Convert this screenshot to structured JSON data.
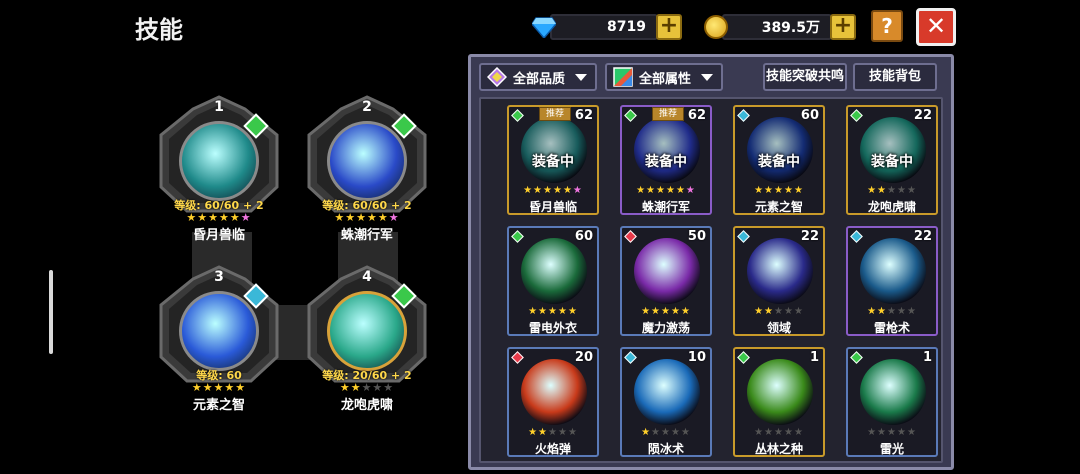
{
  "header": {
    "title": "技能"
  },
  "currency": {
    "gems": "8719",
    "coins": "389.5万",
    "plus": "+",
    "gem_color": "#2aa8ff",
    "coin_color": "#ffd23a"
  },
  "buttons": {
    "help": "?",
    "close": "✕"
  },
  "slots": [
    {
      "num": "1",
      "level": "等级: 60/60 + 2",
      "stars": "★★★★★",
      "extra": "★",
      "name": "昏月兽临",
      "orb": "#1f8a8a",
      "badge": "#3ac84a"
    },
    {
      "num": "2",
      "level": "等级: 60/60 + 2",
      "stars": "★★★★★",
      "extra": "★",
      "name": "蛛潮行军",
      "orb": "#2a4ac8",
      "badge": "#3ac84a"
    },
    {
      "num": "3",
      "level": "等级: 60",
      "stars": "★★★★★",
      "extra": "",
      "name": "元素之智",
      "orb": "#2a5ad8",
      "badge": "#3ab8d8"
    },
    {
      "num": "4",
      "level": "等级: 20/60 + 2",
      "stars": "★★",
      "extra": "★★★",
      "name": "龙咆虎啸",
      "orb": "#2aa88a",
      "badge": "#3ac84a"
    }
  ],
  "panel": {
    "filter_quality": "全部品质",
    "filter_attribute": "全部属性",
    "btn_resonance": "技能突破共鸣",
    "btn_bag": "技能背包"
  },
  "cards": [
    {
      "name": "昏月兽临",
      "count": "62",
      "rec": "推荐",
      "equipped": "装备中",
      "stars": "★★★★★",
      "dim": "",
      "extra": "★",
      "orb": "#1f7a7a",
      "gem": "#3ac84a",
      "border": "gold"
    },
    {
      "name": "蛛潮行军",
      "count": "62",
      "rec": "推荐",
      "equipped": "装备中",
      "stars": "★★★★★",
      "dim": "",
      "extra": "★",
      "orb": "#2a3ab8",
      "gem": "#3ac84a",
      "border": "purple"
    },
    {
      "name": "元素之智",
      "count": "60",
      "rec": "",
      "equipped": "装备中",
      "stars": "★★★★★",
      "dim": "",
      "extra": "",
      "orb": "#1a3a9a",
      "gem": "#3ab8d8",
      "border": "gold"
    },
    {
      "name": "龙咆虎啸",
      "count": "22",
      "rec": "",
      "equipped": "装备中",
      "stars": "★★",
      "dim": "★★★",
      "extra": "",
      "orb": "#1a8a7a",
      "gem": "#3ac84a",
      "border": "gold"
    },
    {
      "name": "雷电外衣",
      "count": "60",
      "rec": "",
      "equipped": "",
      "stars": "★★★★★",
      "dim": "",
      "extra": "",
      "orb": "#1a6a3a",
      "gem": "#3ac84a",
      "border": "blue"
    },
    {
      "name": "魔力激荡",
      "count": "50",
      "rec": "",
      "equipped": "",
      "stars": "★★★★★",
      "dim": "",
      "extra": "",
      "orb": "#7a2aa8",
      "gem": "#e83a4a",
      "border": "blue"
    },
    {
      "name": "领域",
      "count": "22",
      "rec": "",
      "equipped": "",
      "stars": "★★",
      "dim": "★★★",
      "extra": "",
      "orb": "#2a2a8a",
      "gem": "#3ab8d8",
      "border": "gold"
    },
    {
      "name": "雷枪术",
      "count": "22",
      "rec": "",
      "equipped": "",
      "stars": "★★",
      "dim": "★★★",
      "extra": "",
      "orb": "#1a5a8a",
      "gem": "#3ab8d8",
      "border": "purple"
    },
    {
      "name": "火焰弹",
      "count": "20",
      "rec": "",
      "equipped": "",
      "stars": "★★",
      "dim": "★★★",
      "extra": "",
      "orb": "#c83a1a",
      "gem": "#e83a4a",
      "border": "blue"
    },
    {
      "name": "陨冰术",
      "count": "10",
      "rec": "",
      "equipped": "",
      "stars": "★",
      "dim": "★★★★",
      "extra": "",
      "orb": "#1a6ab8",
      "gem": "#3ab8d8",
      "border": "blue"
    },
    {
      "name": "丛林之种",
      "count": "1",
      "rec": "",
      "equipped": "",
      "stars": "",
      "dim": "★★★★★",
      "extra": "",
      "orb": "#3a8a1a",
      "gem": "#3ac84a",
      "border": "gold"
    },
    {
      "name": "雷光",
      "count": "1",
      "rec": "",
      "equipped": "",
      "stars": "",
      "dim": "★★★★★",
      "extra": "",
      "orb": "#1a7a4a",
      "gem": "#3ac84a",
      "border": "blue"
    }
  ]
}
